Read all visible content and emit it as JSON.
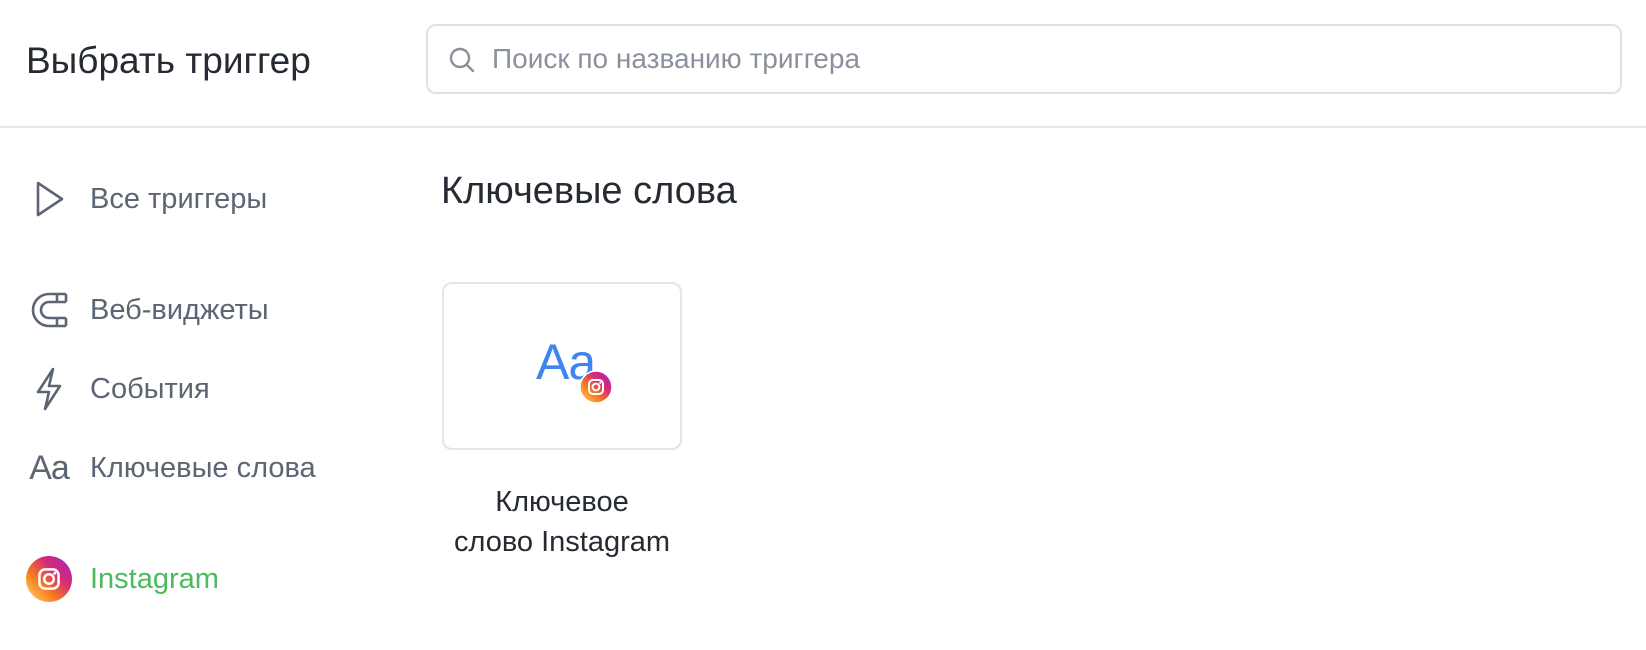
{
  "header": {
    "title": "Выбрать триггер",
    "search": {
      "placeholder": "Поиск по названию триггера",
      "value": "",
      "icon": "search-icon"
    }
  },
  "sidebar": {
    "items": [
      {
        "label": "Все триггеры",
        "icon": "play-icon"
      },
      {
        "label": "Веб-виджеты",
        "icon": "magnet-icon"
      },
      {
        "label": "События",
        "icon": "lightning-icon"
      },
      {
        "label": "Ключевые слова",
        "icon": "text-aa-icon",
        "glyph": "Aa"
      },
      {
        "label": "Instagram",
        "icon": "instagram-icon",
        "active": true
      }
    ]
  },
  "main": {
    "section_title": "Ключевые слова",
    "cards": [
      {
        "glyph": "Aa",
        "caption_line1": "Ключевое",
        "caption_line2": "слово Instagram",
        "badge_icon": "instagram-icon"
      }
    ]
  },
  "colors": {
    "text_primary": "#252a33",
    "text_secondary": "#5c6573",
    "active_green": "#4cbb5d",
    "accent_blue": "#3d86f0",
    "border": "#e2e5e9",
    "instagram_gradient": [
      "#feda75",
      "#fa7e1e",
      "#d62976",
      "#962fbf"
    ]
  }
}
